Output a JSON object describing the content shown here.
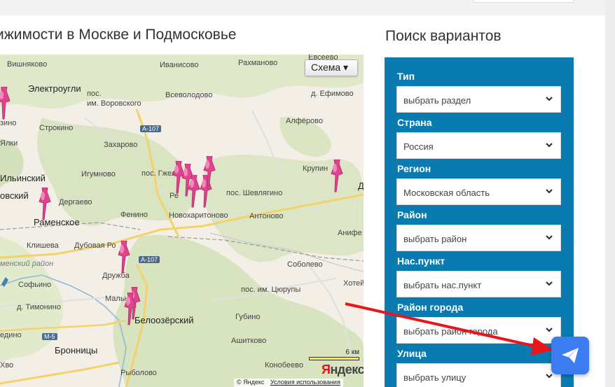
{
  "map_title": "ижимости в Москве и Подмосковье",
  "search_title": "Поиск вариантов",
  "map": {
    "scheme_button": "Схема ▾",
    "scale_label": "6 км",
    "logo_rest": "ндекс",
    "logo_first": "Я",
    "attribution": "© Яндекс",
    "terms_link": "Условия использования",
    "places": {
      "vishnyakovo": "Вишняково",
      "ivanisovo": "Иванисово",
      "rakhmanovo": "Рахманово",
      "evseevo": "Евсеево",
      "elektrougli": "Электроугли",
      "vsevolodovo": "Всеволодово",
      "efimovo": "д. Ефимово",
      "vorovskogo": "пос.\nим. Воровского",
      "zino": "зино",
      "strokino": "Строкино",
      "alferovo": "Алфёрово",
      "yalki": "Ялки",
      "zakharovo": "Захарово",
      "gzhel": "пос. Гжель",
      "igumnovo": "Игумново",
      "krupino": "Крупин",
      "ilinsky": "Ильинский",
      "ovsky": "овский",
      "dergaevo": "Дергаево",
      "shevlyagino": "пос. Шевлягино",
      "ramenskoe": "Раменское",
      "fenino": "Фенино",
      "novokharitonovo": "Новохаритоново",
      "antonovo": "Антоново",
      "anif": "Анифе",
      "klisheva": "Клишева",
      "dubovaya": "Дубовая Ро",
      "druzhba": "Дружба",
      "ramensky_rayon": "менский район",
      "sobolevo": "Соболево",
      "sofino": "Софьино",
      "tsyurupy": "пос. им. Цюрупы",
      "khotei": "Хотей",
      "malino": "Мальн",
      "timonino": "д. Тимонино",
      "beloozersky": "Белоозёрский",
      "gubino": "Губино",
      "edino": "едино",
      "ashitkovo": "Ашитково",
      "bronnitsy": "Бронницы",
      "konobeevo": "Конобеево",
      "rybolovo": "Рыболово",
      "re": "Ре",
      "d": "Д",
      "khvo": "Хво"
    },
    "highways": {
      "a107_top": "А-107",
      "a107_mid": "А-107",
      "m5": "М-5"
    }
  },
  "search": {
    "fields": [
      {
        "label": "Тип",
        "value": "выбрать раздел"
      },
      {
        "label": "Страна",
        "value": "Россия"
      },
      {
        "label": "Регион",
        "value": "Московская область"
      },
      {
        "label": "Район",
        "value": "выбрать район"
      },
      {
        "label": "Нас.пункт",
        "value": "выбрать нас.пункт"
      },
      {
        "label": "Район города",
        "value": "выбрать район города"
      },
      {
        "label": "Улица",
        "value": "выбрать улицу"
      }
    ]
  },
  "colors": {
    "panel_blue": "#0a7bb1",
    "pin_pink": "#e0438f",
    "send_button": "#3b7cf0",
    "annotation_arrow": "#e8161b"
  },
  "icons": {
    "chevron": "chevron-down-icon",
    "send": "paper-plane-icon",
    "pin": "map-pin-icon"
  }
}
